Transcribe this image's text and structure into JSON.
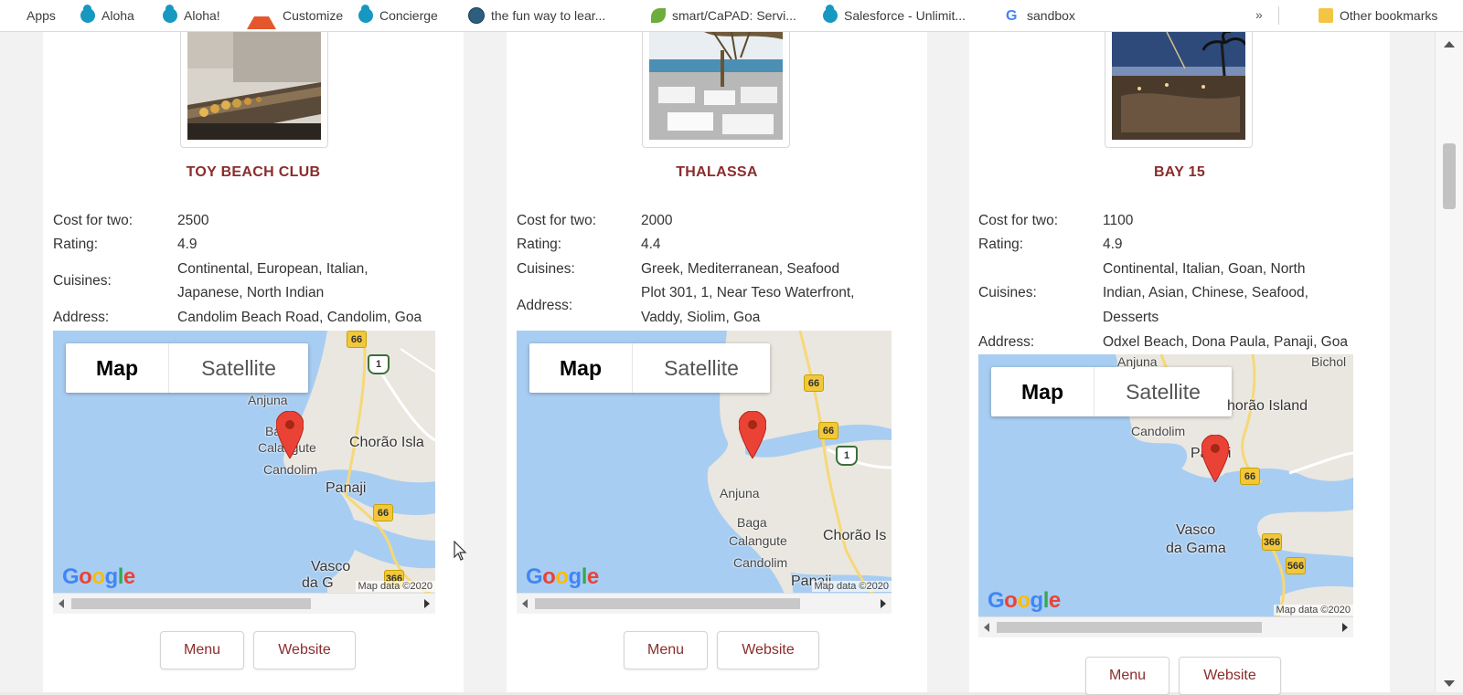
{
  "bookmarks": {
    "items": [
      {
        "label": "Apps",
        "icon": "apps-grid-icon"
      },
      {
        "label": "Aloha",
        "icon": "salesforce-cloud-icon"
      },
      {
        "label": "Aloha!",
        "icon": "salesforce-cloud-icon"
      },
      {
        "label": "Customize",
        "icon": "customize-icon"
      },
      {
        "label": "Concierge",
        "icon": "salesforce-cloud-icon"
      },
      {
        "label": "the fun way to lear...",
        "icon": "trailhead-icon"
      },
      {
        "label": "smart/CaPAD: Servi...",
        "icon": "leaf-icon"
      },
      {
        "label": "Salesforce - Unlimit...",
        "icon": "salesforce-cloud-icon"
      },
      {
        "label": "sandbox",
        "icon": "google-icon"
      }
    ],
    "more": "»",
    "other": "Other bookmarks"
  },
  "labels": {
    "cost": "Cost for two:",
    "rating": "Rating:",
    "cuisines": "Cuisines:",
    "address": "Address:"
  },
  "map_ui": {
    "map": "Map",
    "satellite": "Satellite",
    "map_data": "Map data ©2020"
  },
  "buttons": {
    "menu": "Menu",
    "website": "Website"
  },
  "restaurants": [
    {
      "name": "TOY BEACH CLUB",
      "cost": "2500",
      "rating": "4.9",
      "cuisines": [
        "Continental, European, Italian,",
        "Japanese, North Indian"
      ],
      "address": "Candolim Beach Road, Candolim, Goa",
      "places": [
        "Anjuna",
        "Baga",
        "Calangute",
        "Candolim",
        "Chorão Isla",
        "Panaji",
        "Vasco",
        "da G"
      ],
      "highways": [
        "66",
        "1",
        "66",
        "366"
      ]
    },
    {
      "name": "THALASSA",
      "cost": "2000",
      "rating": "4.4",
      "cuisines": [
        "Greek, Mediterranean, Seafood"
      ],
      "address": [
        "Plot 301, 1, Near Teso Waterfront,",
        "Vaddy, Siolim, Goa"
      ],
      "places": [
        "Anjuna",
        "Baga",
        "Calangute",
        "Candolim",
        "Chorão Is",
        "Panaji"
      ],
      "highways": [
        "66",
        "66",
        "1"
      ]
    },
    {
      "name": "BAY 15",
      "cost": "1100",
      "rating": "4.9",
      "cuisines": [
        "Continental, Italian, Goan, North",
        "Indian, Asian, Chinese, Seafood,",
        "Desserts"
      ],
      "address": "Odxel Beach, Dona Paula, Panaji, Goa",
      "places": [
        "Anjuna",
        "Bichol",
        "horão Island",
        "Candolim",
        "Panaji",
        "Vasco",
        "da Gama"
      ],
      "highways": [
        "66",
        "366",
        "566"
      ]
    }
  ]
}
